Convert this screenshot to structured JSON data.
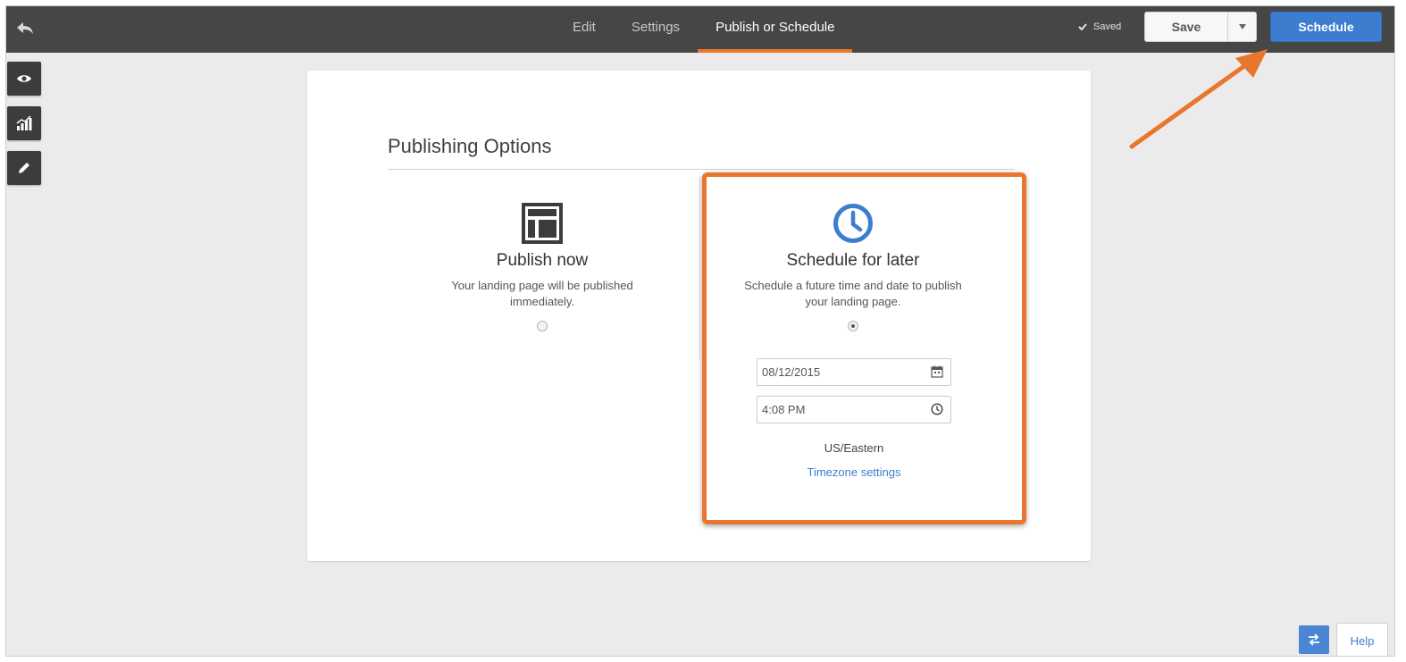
{
  "topbar": {
    "back_icon": "back-arrow-icon",
    "tabs": [
      {
        "label": "Edit",
        "active": false
      },
      {
        "label": "Settings",
        "active": false
      },
      {
        "label": "Publish or Schedule",
        "active": true
      }
    ],
    "saved_label": "Saved",
    "save_label": "Save",
    "schedule_label": "Schedule"
  },
  "tools": [
    {
      "icon": "eye-icon"
    },
    {
      "icon": "analytics-icon"
    },
    {
      "icon": "pencil-icon"
    }
  ],
  "publishing": {
    "title": "Publishing Options",
    "publish_now": {
      "title": "Publish now",
      "description": "Your landing page will be published immediately.",
      "selected": false
    },
    "schedule_later": {
      "title": "Schedule for later",
      "description": "Schedule a future time and date to publish your landing page.",
      "selected": true,
      "date": "08/12/2015",
      "time": "4:08 PM",
      "timezone": "US/Eastern",
      "timezone_link": "Timezone settings"
    }
  },
  "footer": {
    "help_label": "Help"
  },
  "colors": {
    "accent": "#e8762c",
    "primary": "#3d7dd0",
    "topbar": "#464646"
  }
}
